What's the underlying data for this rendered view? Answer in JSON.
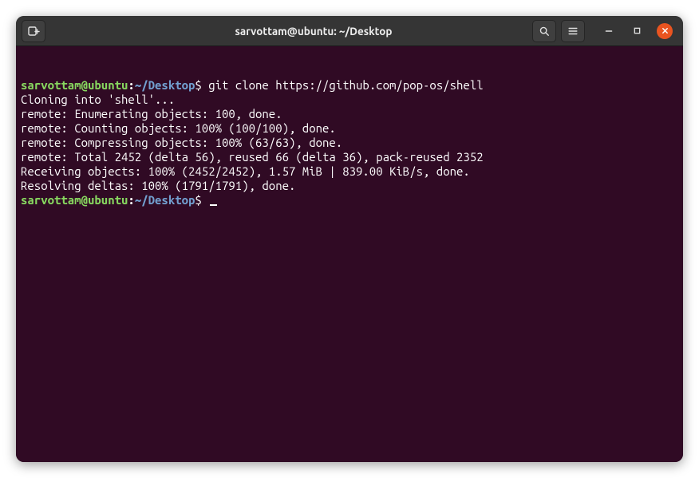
{
  "window": {
    "title": "sarvottam@ubuntu: ~/Desktop"
  },
  "prompt": {
    "user_host": "sarvottam@ubuntu",
    "colon": ":",
    "path": "~/Desktop",
    "symbol": "$"
  },
  "command": "git clone https://github.com/pop-os/shell",
  "output": [
    "Cloning into 'shell'...",
    "remote: Enumerating objects: 100, done.",
    "remote: Counting objects: 100% (100/100), done.",
    "remote: Compressing objects: 100% (63/63), done.",
    "remote: Total 2452 (delta 56), reused 66 (delta 36), pack-reused 2352",
    "Receiving objects: 100% (2452/2452), 1.57 MiB | 839.00 KiB/s, done.",
    "Resolving deltas: 100% (1791/1791), done."
  ],
  "icons": {
    "new_tab": "new-tab-icon",
    "search": "search-icon",
    "menu": "hamburger-icon",
    "minimize": "minimize-icon",
    "maximize": "maximize-icon",
    "close": "close-icon"
  }
}
